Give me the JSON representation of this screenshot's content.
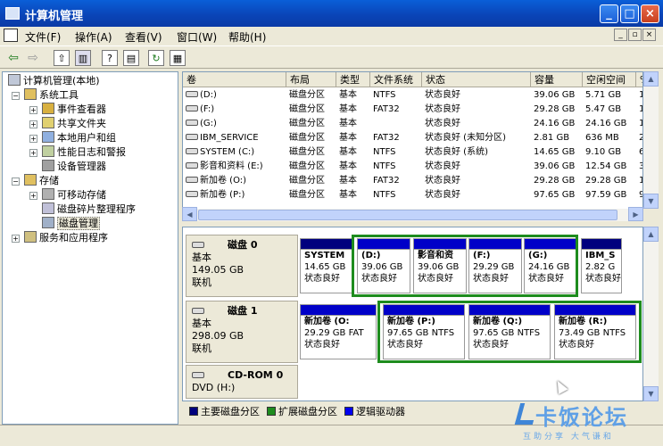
{
  "window": {
    "title": "计算机管理"
  },
  "menus": [
    "文件(F)",
    "操作(A)",
    "查看(V)",
    "窗口(W)",
    "帮助(H)"
  ],
  "mdi_buttons": [
    "_",
    "▫",
    "×"
  ],
  "tree": [
    {
      "label": "计算机管理(本地)",
      "level": 0,
      "expander": "",
      "icon": "computer-management-icon"
    },
    {
      "label": "系统工具",
      "level": 1,
      "expander": "−",
      "icon": "system-tools-icon"
    },
    {
      "label": "事件查看器",
      "level": 2,
      "expander": "+",
      "icon": "event-viewer-icon"
    },
    {
      "label": "共享文件夹",
      "level": 2,
      "expander": "+",
      "icon": "shared-folder-icon"
    },
    {
      "label": "本地用户和组",
      "level": 2,
      "expander": "+",
      "icon": "users-icon"
    },
    {
      "label": "性能日志和警报",
      "level": 2,
      "expander": "+",
      "icon": "performance-icon"
    },
    {
      "label": "设备管理器",
      "level": 2,
      "expander": "",
      "icon": "device-manager-icon"
    },
    {
      "label": "存储",
      "level": 1,
      "expander": "−",
      "icon": "storage-icon"
    },
    {
      "label": "可移动存储",
      "level": 2,
      "expander": "+",
      "icon": "removable-storage-icon"
    },
    {
      "label": "磁盘碎片整理程序",
      "level": 2,
      "expander": "",
      "icon": "defrag-icon"
    },
    {
      "label": "磁盘管理",
      "level": 2,
      "expander": "",
      "icon": "disk-management-icon",
      "selected": true
    },
    {
      "label": "服务和应用程序",
      "level": 1,
      "expander": "+",
      "icon": "services-icon"
    }
  ],
  "volume_table": {
    "columns": [
      "卷",
      "布局",
      "类型",
      "文件系统",
      "状态",
      "容量",
      "空闲空间",
      "%"
    ],
    "rows": [
      [
        "(D:)",
        "磁盘分区",
        "基本",
        "NTFS",
        "状态良好",
        "39.06 GB",
        "5.71 GB",
        "1"
      ],
      [
        "(F:)",
        "磁盘分区",
        "基本",
        "FAT32",
        "状态良好",
        "29.28 GB",
        "5.47 GB",
        "1"
      ],
      [
        "(G:)",
        "磁盘分区",
        "基本",
        "",
        "状态良好",
        "24.16 GB",
        "24.16 GB",
        "1"
      ],
      [
        "IBM_SERVICE",
        "磁盘分区",
        "基本",
        "FAT32",
        "状态良好 (未知分区)",
        "2.81 GB",
        "636 MB",
        "2"
      ],
      [
        "SYSTEM (C:)",
        "磁盘分区",
        "基本",
        "NTFS",
        "状态良好 (系统)",
        "14.65 GB",
        "9.10 GB",
        "6"
      ],
      [
        "影音和资料 (E:)",
        "磁盘分区",
        "基本",
        "NTFS",
        "状态良好",
        "39.06 GB",
        "12.54 GB",
        "3"
      ],
      [
        "新加卷 (O:)",
        "磁盘分区",
        "基本",
        "FAT32",
        "状态良好",
        "29.28 GB",
        "29.28 GB",
        "1"
      ],
      [
        "新加卷 (P:)",
        "磁盘分区",
        "基本",
        "NTFS",
        "状态良好",
        "97.65 GB",
        "97.59 GB",
        "9"
      ]
    ]
  },
  "disks": [
    {
      "name": "磁盘 0",
      "type": "基本",
      "size": "149.05 GB",
      "status": "联机",
      "partitions": [
        {
          "label": "SYSTEM",
          "size": "14.65 GB",
          "status": "状态良好"
        },
        {
          "label": "(D:)",
          "size": "39.06 GB",
          "status": "状态良好"
        },
        {
          "label": "影音和资",
          "size": "39.06 GB",
          "status": "状态良好"
        },
        {
          "label": "(F:)",
          "size": "29.29 GB",
          "status": "状态良好"
        },
        {
          "label": "(G:)",
          "size": "24.16 GB",
          "status": "状态良好"
        },
        {
          "label": "IBM_S",
          "size": "2.82 G",
          "status": "状态良好"
        }
      ]
    },
    {
      "name": "磁盘 1",
      "type": "基本",
      "size": "298.09 GB",
      "status": "联机",
      "partitions": [
        {
          "label": "新加卷 (O:",
          "size": "29.29 GB FAT",
          "status": "状态良好"
        },
        {
          "label": "新加卷 (P:)",
          "size": "97.65 GB NTFS",
          "status": "状态良好"
        },
        {
          "label": "新加卷 (Q:)",
          "size": "97.65 GB NTFS",
          "status": "状态良好"
        },
        {
          "label": "新加卷 (R:)",
          "size": "73.49 GB NTFS",
          "status": "状态良好"
        }
      ]
    },
    {
      "name": "CD-ROM 0",
      "type": "DVD (H:)",
      "size": "",
      "status": ""
    }
  ],
  "legend": [
    {
      "label": "主要磁盘分区",
      "color": "#00007e"
    },
    {
      "label": "扩展磁盘分区",
      "color": "#1e8c1e"
    },
    {
      "label": "逻辑驱动器",
      "color": "#0000f0"
    }
  ],
  "watermark": {
    "main": "卡饭论坛",
    "sub": "互助分享 大气谦和"
  }
}
